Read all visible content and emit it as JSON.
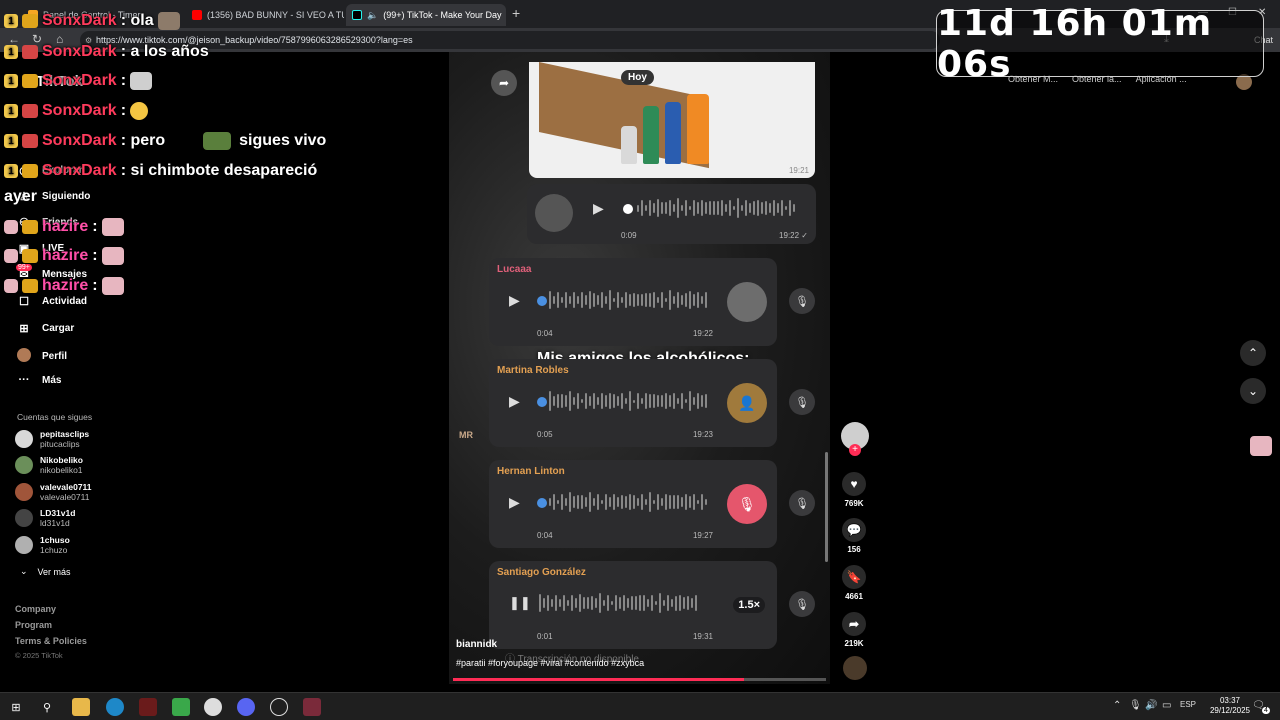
{
  "browser": {
    "tabs": [
      {
        "label": "Panel de Control - Timer",
        "favicon_color": "#f5a623"
      },
      {
        "label": "(1356) BAD BUNNY - SI VEO A TU M",
        "favicon_color": "#ff0000"
      },
      {
        "label": "(99+) TikTok - Make Your Day",
        "favicon_color": "#25f4ee"
      }
    ],
    "url": "https://www.tiktok.com/@jeison_backup/video/7587996063286529300?lang=es",
    "bookmarks": [
      "Obtener M...",
      "Obtener la...",
      "Aplicación ..."
    ],
    "chat_button": "Chat"
  },
  "timer": {
    "text": "11d 16h 01m 06s"
  },
  "sidebar": {
    "logo": "TikTok",
    "items": [
      {
        "label": "Explorar",
        "icon": "compass-icon"
      },
      {
        "label": "Siguiendo",
        "icon": "following-icon"
      },
      {
        "label": "Friends",
        "icon": "friends-icon"
      },
      {
        "label": "LIVE",
        "icon": "live-icon"
      },
      {
        "label": "Mensajes",
        "icon": "messages-icon",
        "badge": "99+"
      },
      {
        "label": "Actividad",
        "icon": "activity-icon"
      },
      {
        "label": "Cargar",
        "icon": "upload-icon"
      },
      {
        "label": "Perfil",
        "icon": "profile-icon"
      },
      {
        "label": "Más",
        "icon": "more-icon"
      }
    ],
    "following_header": "Cuentas que sigues",
    "following": [
      {
        "name": "pepitasclips",
        "user": "pitucaclips",
        "color": "#d8d8d8"
      },
      {
        "name": "Nikobeliko",
        "user": "nikobeliko1",
        "color": "#6b8f5a"
      },
      {
        "name": "valevale0711",
        "user": "valevale0711",
        "color": "#a0553a"
      },
      {
        "name": "LD31v1d",
        "user": "ld31v1d",
        "color": "#444444"
      },
      {
        "name": "1chuso",
        "user": "1chuzo",
        "color": "#b0b0b0"
      }
    ],
    "see_more": "Ver más",
    "footer": [
      "Company",
      "Program",
      "Terms & Policies"
    ],
    "copyright": "© 2025 TikTok"
  },
  "chat": {
    "messages": [
      {
        "nick": "SonxDark",
        "text": ": ola"
      },
      {
        "nick": "SonxDark",
        "text": ": a los años"
      },
      {
        "nick": "SonxDark",
        "text": ":"
      },
      {
        "nick": "SonxDark",
        "text": ":"
      },
      {
        "nick": "SonxDark",
        "text": ": pero",
        "text2": "sigues vivo"
      },
      {
        "nick": "SonxDark",
        "text": ": si chimbote desapareció"
      },
      {
        "nick": "hazire",
        "text": ":"
      },
      {
        "nick": "hazire",
        "text": ":"
      },
      {
        "nick": "hazire",
        "text": ":"
      }
    ],
    "ayer": "ayer"
  },
  "video": {
    "hoy": "Hoy",
    "image_time": "19:21",
    "voice_top": {
      "duration": "0:09",
      "time": "19:22 ✓"
    },
    "messages": [
      {
        "name": "Lucaaa",
        "name_color": "#e0607a",
        "duration": "0:04",
        "time": "19:22"
      },
      {
        "name": "Martina Robles",
        "name_color": "#e3a052",
        "duration": "0:05",
        "time": "19:23"
      },
      {
        "name": "Hernan Linton",
        "name_color": "#e3a052",
        "duration": "0:04",
        "time": "19:27"
      },
      {
        "name": "Santiago González",
        "name_color": "#e3a052",
        "duration": "0:01",
        "time": "19:31",
        "speed": "1.5×"
      }
    ],
    "caption": "Mis amigos los alcohólicos:",
    "initials": "MR",
    "transcription": "Transcripción no disponible",
    "author": "biannidk",
    "hashtags": "#paratii #foryoupage #viral #contenido #zxybca",
    "progress": 0.78
  },
  "actions": {
    "likes": "769K",
    "comments": "156",
    "saves": "4661",
    "shares": "219K"
  },
  "taskbar": {
    "language": "ESP",
    "time": "03:37",
    "date": "29/12/2025",
    "notifications": "4"
  }
}
